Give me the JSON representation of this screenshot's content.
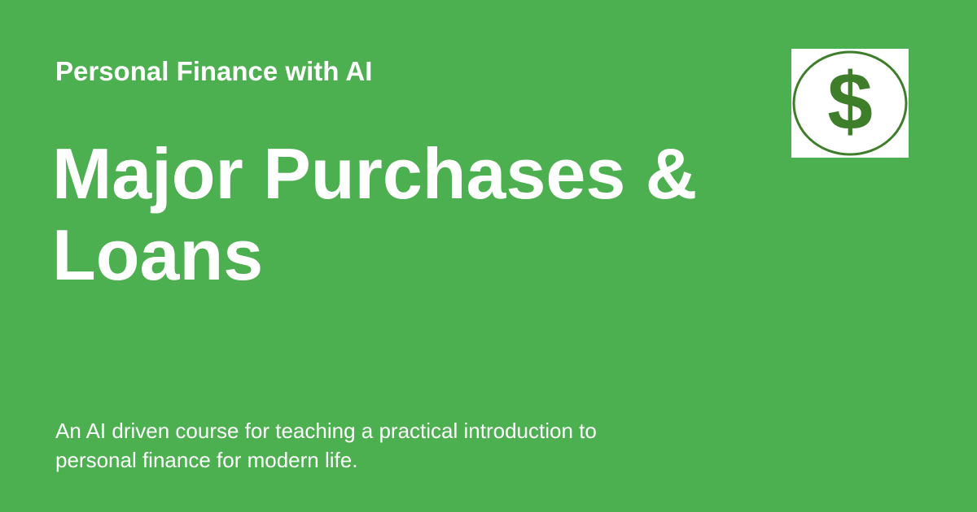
{
  "header": {
    "site_name": "Personal Finance with AI"
  },
  "main": {
    "title": "Major Purchases & Loans",
    "description": "An AI driven course for teaching a practical introduction to personal finance for modern life."
  },
  "logo": {
    "icon": "dollar-sign-icon",
    "symbol": "$",
    "color": "#3E7D2A",
    "background": "#FFFFFF"
  },
  "theme": {
    "background": "#4CAF50",
    "text": "#FFFFFF"
  }
}
